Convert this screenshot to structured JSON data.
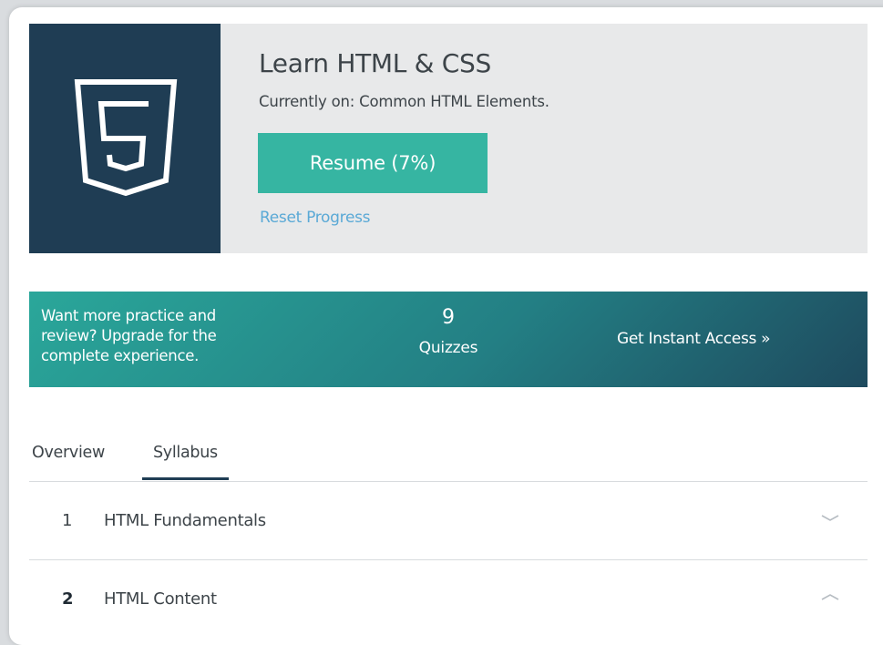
{
  "course": {
    "title": "Learn HTML & CSS",
    "current": "Currently on: Common HTML Elements.",
    "resume_label": "Resume (7%)",
    "progress_percent": 7,
    "reset_label": "Reset Progress",
    "logo_icon": "html5-shield-icon"
  },
  "upgrade": {
    "text": "Want more practice and review? Upgrade for the complete experience.",
    "count": "9",
    "count_label": "Quizzes",
    "cta_label": "Get Instant Access »"
  },
  "tabs": [
    {
      "label": "Overview",
      "active": false
    },
    {
      "label": "Syllabus",
      "active": true
    }
  ],
  "syllabus": [
    {
      "number": "1",
      "title": "HTML Fundamentals",
      "expanded": false,
      "chevron_icon": "chevron-down-icon"
    },
    {
      "number": "2",
      "title": "HTML Content",
      "expanded": true,
      "chevron_icon": "chevron-up-icon"
    }
  ],
  "colors": {
    "logo_bg": "#1f3d54",
    "resume_btn": "#36b5a2",
    "link": "#5aa9d6",
    "banner_start": "#2aa79a",
    "banner_end": "#1e4a5e"
  }
}
